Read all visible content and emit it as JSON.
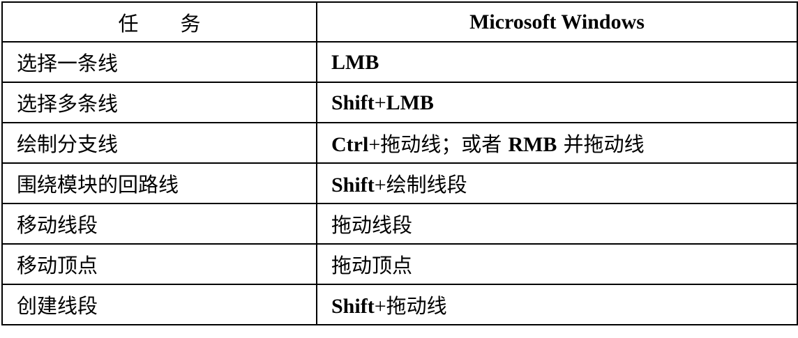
{
  "header": {
    "task": "任务",
    "windows": "Microsoft Windows"
  },
  "rows": [
    {
      "task": "选择一条线",
      "windows": [
        {
          "text": "LMB",
          "style": "key"
        }
      ]
    },
    {
      "task": "选择多条线",
      "windows": [
        {
          "text": "Shift",
          "style": "key"
        },
        {
          "text": "+",
          "style": "plus"
        },
        {
          "text": "LMB",
          "style": "key"
        }
      ]
    },
    {
      "task": "绘制分支线",
      "windows": [
        {
          "text": "Ctrl",
          "style": "key"
        },
        {
          "text": "+",
          "style": "plus"
        },
        {
          "text": "拖动线；或者 ",
          "style": "text"
        },
        {
          "text": "RMB",
          "style": "key"
        },
        {
          "text": " 并拖动线",
          "style": "text"
        }
      ]
    },
    {
      "task": "围绕模块的回路线",
      "windows": [
        {
          "text": "Shift",
          "style": "key"
        },
        {
          "text": "+",
          "style": "plus"
        },
        {
          "text": "绘制线段",
          "style": "text"
        }
      ]
    },
    {
      "task": "移动线段",
      "windows": [
        {
          "text": "拖动线段",
          "style": "text"
        }
      ]
    },
    {
      "task": "移动顶点",
      "windows": [
        {
          "text": "拖动顶点",
          "style": "text"
        }
      ]
    },
    {
      "task": "创建线段",
      "windows": [
        {
          "text": "Shift",
          "style": "key"
        },
        {
          "text": "+",
          "style": "plus"
        },
        {
          "text": "拖动线",
          "style": "text"
        }
      ]
    }
  ]
}
